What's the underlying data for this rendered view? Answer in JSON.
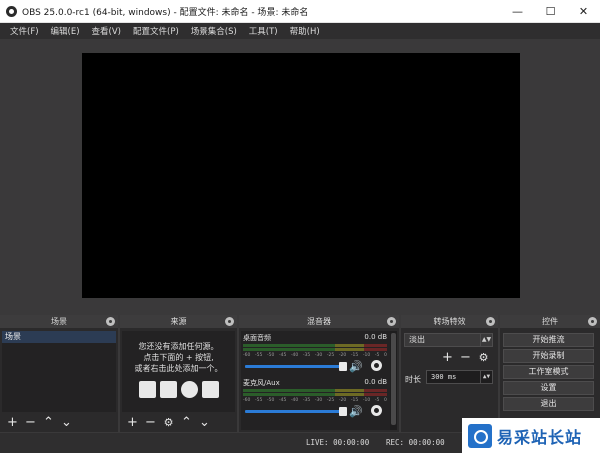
{
  "window": {
    "title": "OBS 25.0.0-rc1 (64-bit, windows) - 配置文件: 未命名 - 场景: 未命名",
    "minimize": "—",
    "maximize": "☐",
    "close": "✕"
  },
  "menu": {
    "items": [
      "文件(F)",
      "编辑(E)",
      "查看(V)",
      "配置文件(P)",
      "场景集合(S)",
      "工具(T)",
      "帮助(H)"
    ]
  },
  "docks": {
    "scenes": {
      "title": "场景",
      "items": [
        "场景"
      ]
    },
    "sources": {
      "title": "来源",
      "empty_line1": "您还没有添加任何源。",
      "empty_line2": "点击下面的 + 按钮,",
      "empty_line3": "或者右击此处添加一个。"
    },
    "mixer": {
      "title": "混音器",
      "tracks": [
        {
          "name": "桌面音频",
          "db": "0.0 dB",
          "volume": 1.0
        },
        {
          "name": "麦克风/Aux",
          "db": "0.0 dB",
          "volume": 1.0
        }
      ],
      "scale": [
        "-60",
        "-55",
        "-50",
        "-45",
        "-40",
        "-35",
        "-30",
        "-25",
        "-20",
        "-15",
        "-10",
        "-5",
        "0"
      ]
    },
    "transitions": {
      "title": "转场特效",
      "selected": "淡出",
      "duration_label": "时长",
      "duration_value": "300 ms"
    },
    "controls": {
      "title": "控件",
      "buttons": [
        "开始推流",
        "开始录制",
        "工作室模式",
        "设置",
        "退出"
      ]
    }
  },
  "toolbar_glyphs": {
    "add": "+",
    "remove": "−",
    "up": "⌃",
    "down": "⌄",
    "settings": "⚙"
  },
  "status": {
    "live": "LIVE: 00:00:00",
    "rec": "REC: 00:00:00"
  },
  "watermark": {
    "text": "易采站长站"
  },
  "colors": {
    "background": "#3a393a",
    "preview": "#000000",
    "selection": "#2c3c54",
    "fader": "#2b7bd6"
  }
}
